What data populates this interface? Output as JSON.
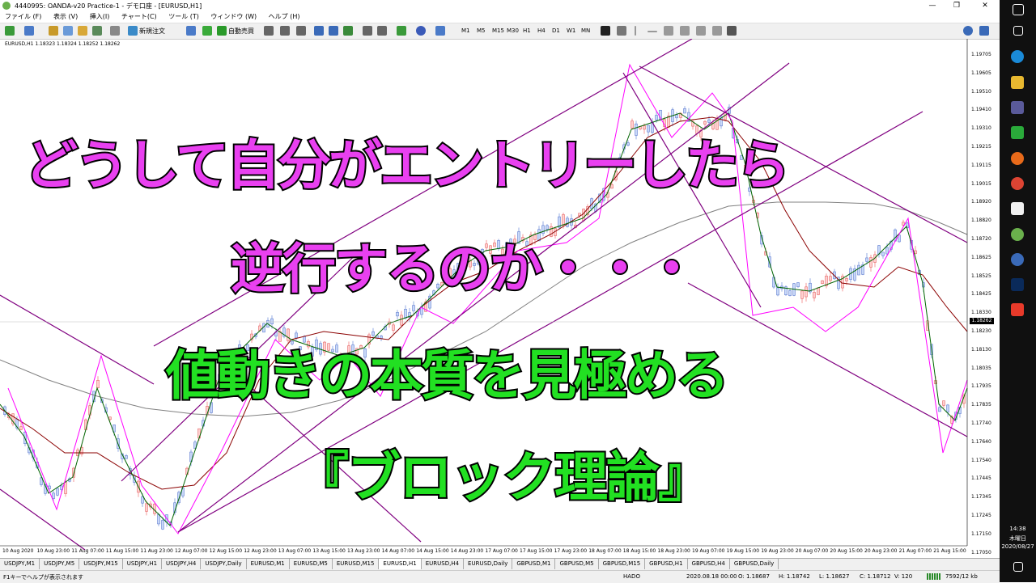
{
  "window": {
    "title": "4440995: OANDA-v20 Practice-1 - デモ口座 - [EURUSD,H1]",
    "min": "—",
    "restore": "❐",
    "close": "✕"
  },
  "menu": [
    "ファイル (F)",
    "表示 (V)",
    "挿入(I)",
    "チャート(C)",
    "ツール (T)",
    "ウィンドウ (W)",
    "ヘルプ (H)"
  ],
  "toolbar": {
    "new_order": "新規注文",
    "auto_trade": "自動売買",
    "timeframes": [
      "M1",
      "M5",
      "M15",
      "M30",
      "H1",
      "H4",
      "D1",
      "W1",
      "MN"
    ]
  },
  "chart": {
    "info": "EURUSD,H1  1.18323 1.18324 1.18252 1.18262",
    "current_price": "1.18262",
    "price_labels": [
      "1.19705",
      "1.19605",
      "1.19510",
      "1.19410",
      "1.19310",
      "1.19215",
      "1.19115",
      "1.19015",
      "1.18920",
      "1.18820",
      "1.18720",
      "1.18625",
      "1.18525",
      "1.18425",
      "1.18330",
      "1.18230",
      "1.18130",
      "1.18035",
      "1.17935",
      "1.17835",
      "1.17740",
      "1.17640",
      "1.17540",
      "1.17445",
      "1.17345",
      "1.17245",
      "1.17150",
      "1.17050"
    ],
    "time_labels": [
      "10 Aug 2020",
      "10 Aug 23:00",
      "11 Aug 07:00",
      "11 Aug 15:00",
      "11 Aug 23:00",
      "12 Aug 07:00",
      "12 Aug 15:00",
      "12 Aug 23:00",
      "13 Aug 07:00",
      "13 Aug 15:00",
      "13 Aug 23:00",
      "14 Aug 07:00",
      "14 Aug 15:00",
      "14 Aug 23:00",
      "17 Aug 07:00",
      "17 Aug 15:00",
      "17 Aug 23:00",
      "18 Aug 07:00",
      "18 Aug 15:00",
      "18 Aug 23:00",
      "19 Aug 07:00",
      "19 Aug 15:00",
      "19 Aug 23:00",
      "20 Aug 07:00",
      "20 Aug 15:00",
      "20 Aug 23:00",
      "21 Aug 07:00",
      "21 Aug 15:00"
    ]
  },
  "captions": {
    "line1": "どうして自分がエントリーしたら",
    "line2": "逆行するのか・・・",
    "line3": "値動きの本質を見極める",
    "line4": "『ブロック理論』"
  },
  "tabs": [
    "USDJPY,M1",
    "USDJPY,M5",
    "USDJPY,M15",
    "USDJPY,H1",
    "USDJPY,H4",
    "USDJPY,Daily",
    "EURUSD,M1",
    "EURUSD,M5",
    "EURUSD,M15",
    "EURUSD,H1",
    "EURUSD,H4",
    "EURUSD,Daily",
    "GBPUSD,M1",
    "GBPUSD,M5",
    "GBPUSD,M15",
    "GBPUSD,H1",
    "GBPUSD,H4",
    "GBPUSD,Daily"
  ],
  "active_tab": "EURUSD,H1",
  "status": {
    "help": "F1キーでヘルプが表示されます",
    "profile": "HADO",
    "datetime": "2020.08.18 00:00",
    "open": "O: 1.18687",
    "high": "H: 1.18742",
    "low": "L: 1.18627",
    "close": "C: 1.18712",
    "volume": "V: 120",
    "traffic": "7592/12 kb"
  },
  "taskbar": {
    "time": "14:38",
    "day": "木曜日",
    "date": "2020/08/27"
  },
  "colors": {
    "caption_magenta": "#e940f0",
    "caption_green": "#22e022",
    "trendline": "#800080",
    "zigzag": "#ff00ff",
    "ma_green": "#006400",
    "ma_red": "#8b0000",
    "ma_gray": "#808080"
  }
}
